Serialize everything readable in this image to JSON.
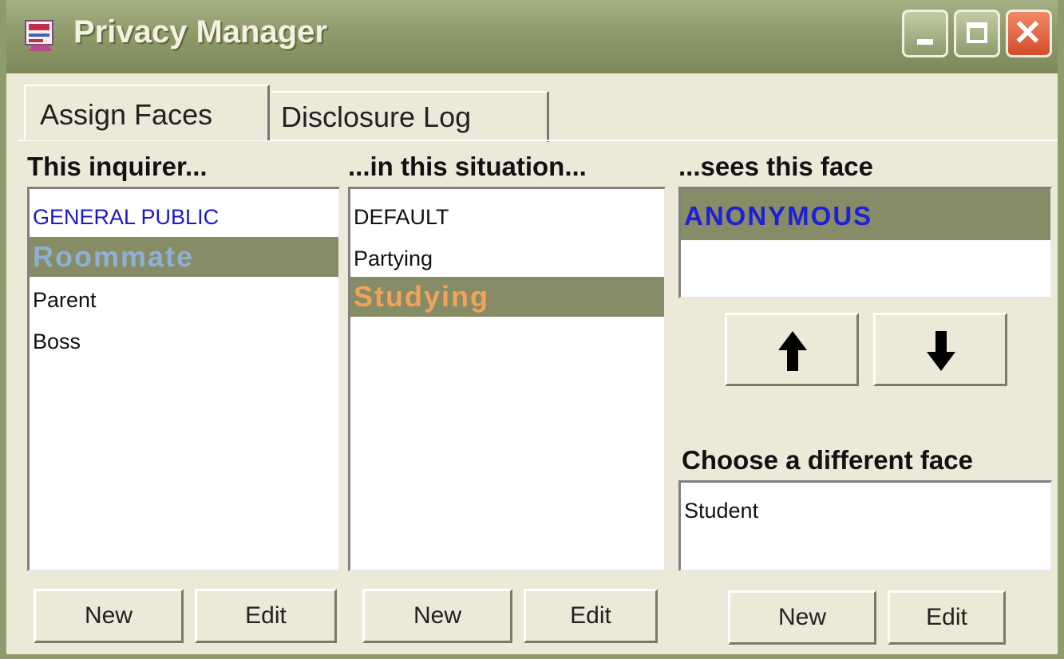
{
  "window": {
    "title": "Privacy Manager"
  },
  "tabs": [
    {
      "label": "Assign Faces",
      "active": true
    },
    {
      "label": "Disclosure Log",
      "active": false
    }
  ],
  "inquirer": {
    "header": "This inquirer...",
    "items": [
      {
        "label": "GENERAL PUBLIC",
        "color": "#1a1ac8"
      },
      {
        "label": "Roommate",
        "selected": true,
        "color": "#8fb0d6"
      },
      {
        "label": "Parent"
      },
      {
        "label": "Boss"
      }
    ],
    "new_label": "New",
    "edit_label": "Edit"
  },
  "situation": {
    "header": "...in this situation...",
    "items": [
      {
        "label": "DEFAULT"
      },
      {
        "label": "Partying"
      },
      {
        "label": "Studying",
        "selected": true,
        "color": "#f2a25a"
      }
    ],
    "new_label": "New",
    "edit_label": "Edit"
  },
  "face": {
    "header": "...sees this face",
    "current": "ANONYMOUS",
    "current_color": "#1f1fd6",
    "up_icon": "arrow-up-icon",
    "down_icon": "arrow-down-icon",
    "choose_header": "Choose a different face",
    "choose_items": [
      "Student"
    ],
    "new_label": "New",
    "edit_label": "Edit"
  }
}
